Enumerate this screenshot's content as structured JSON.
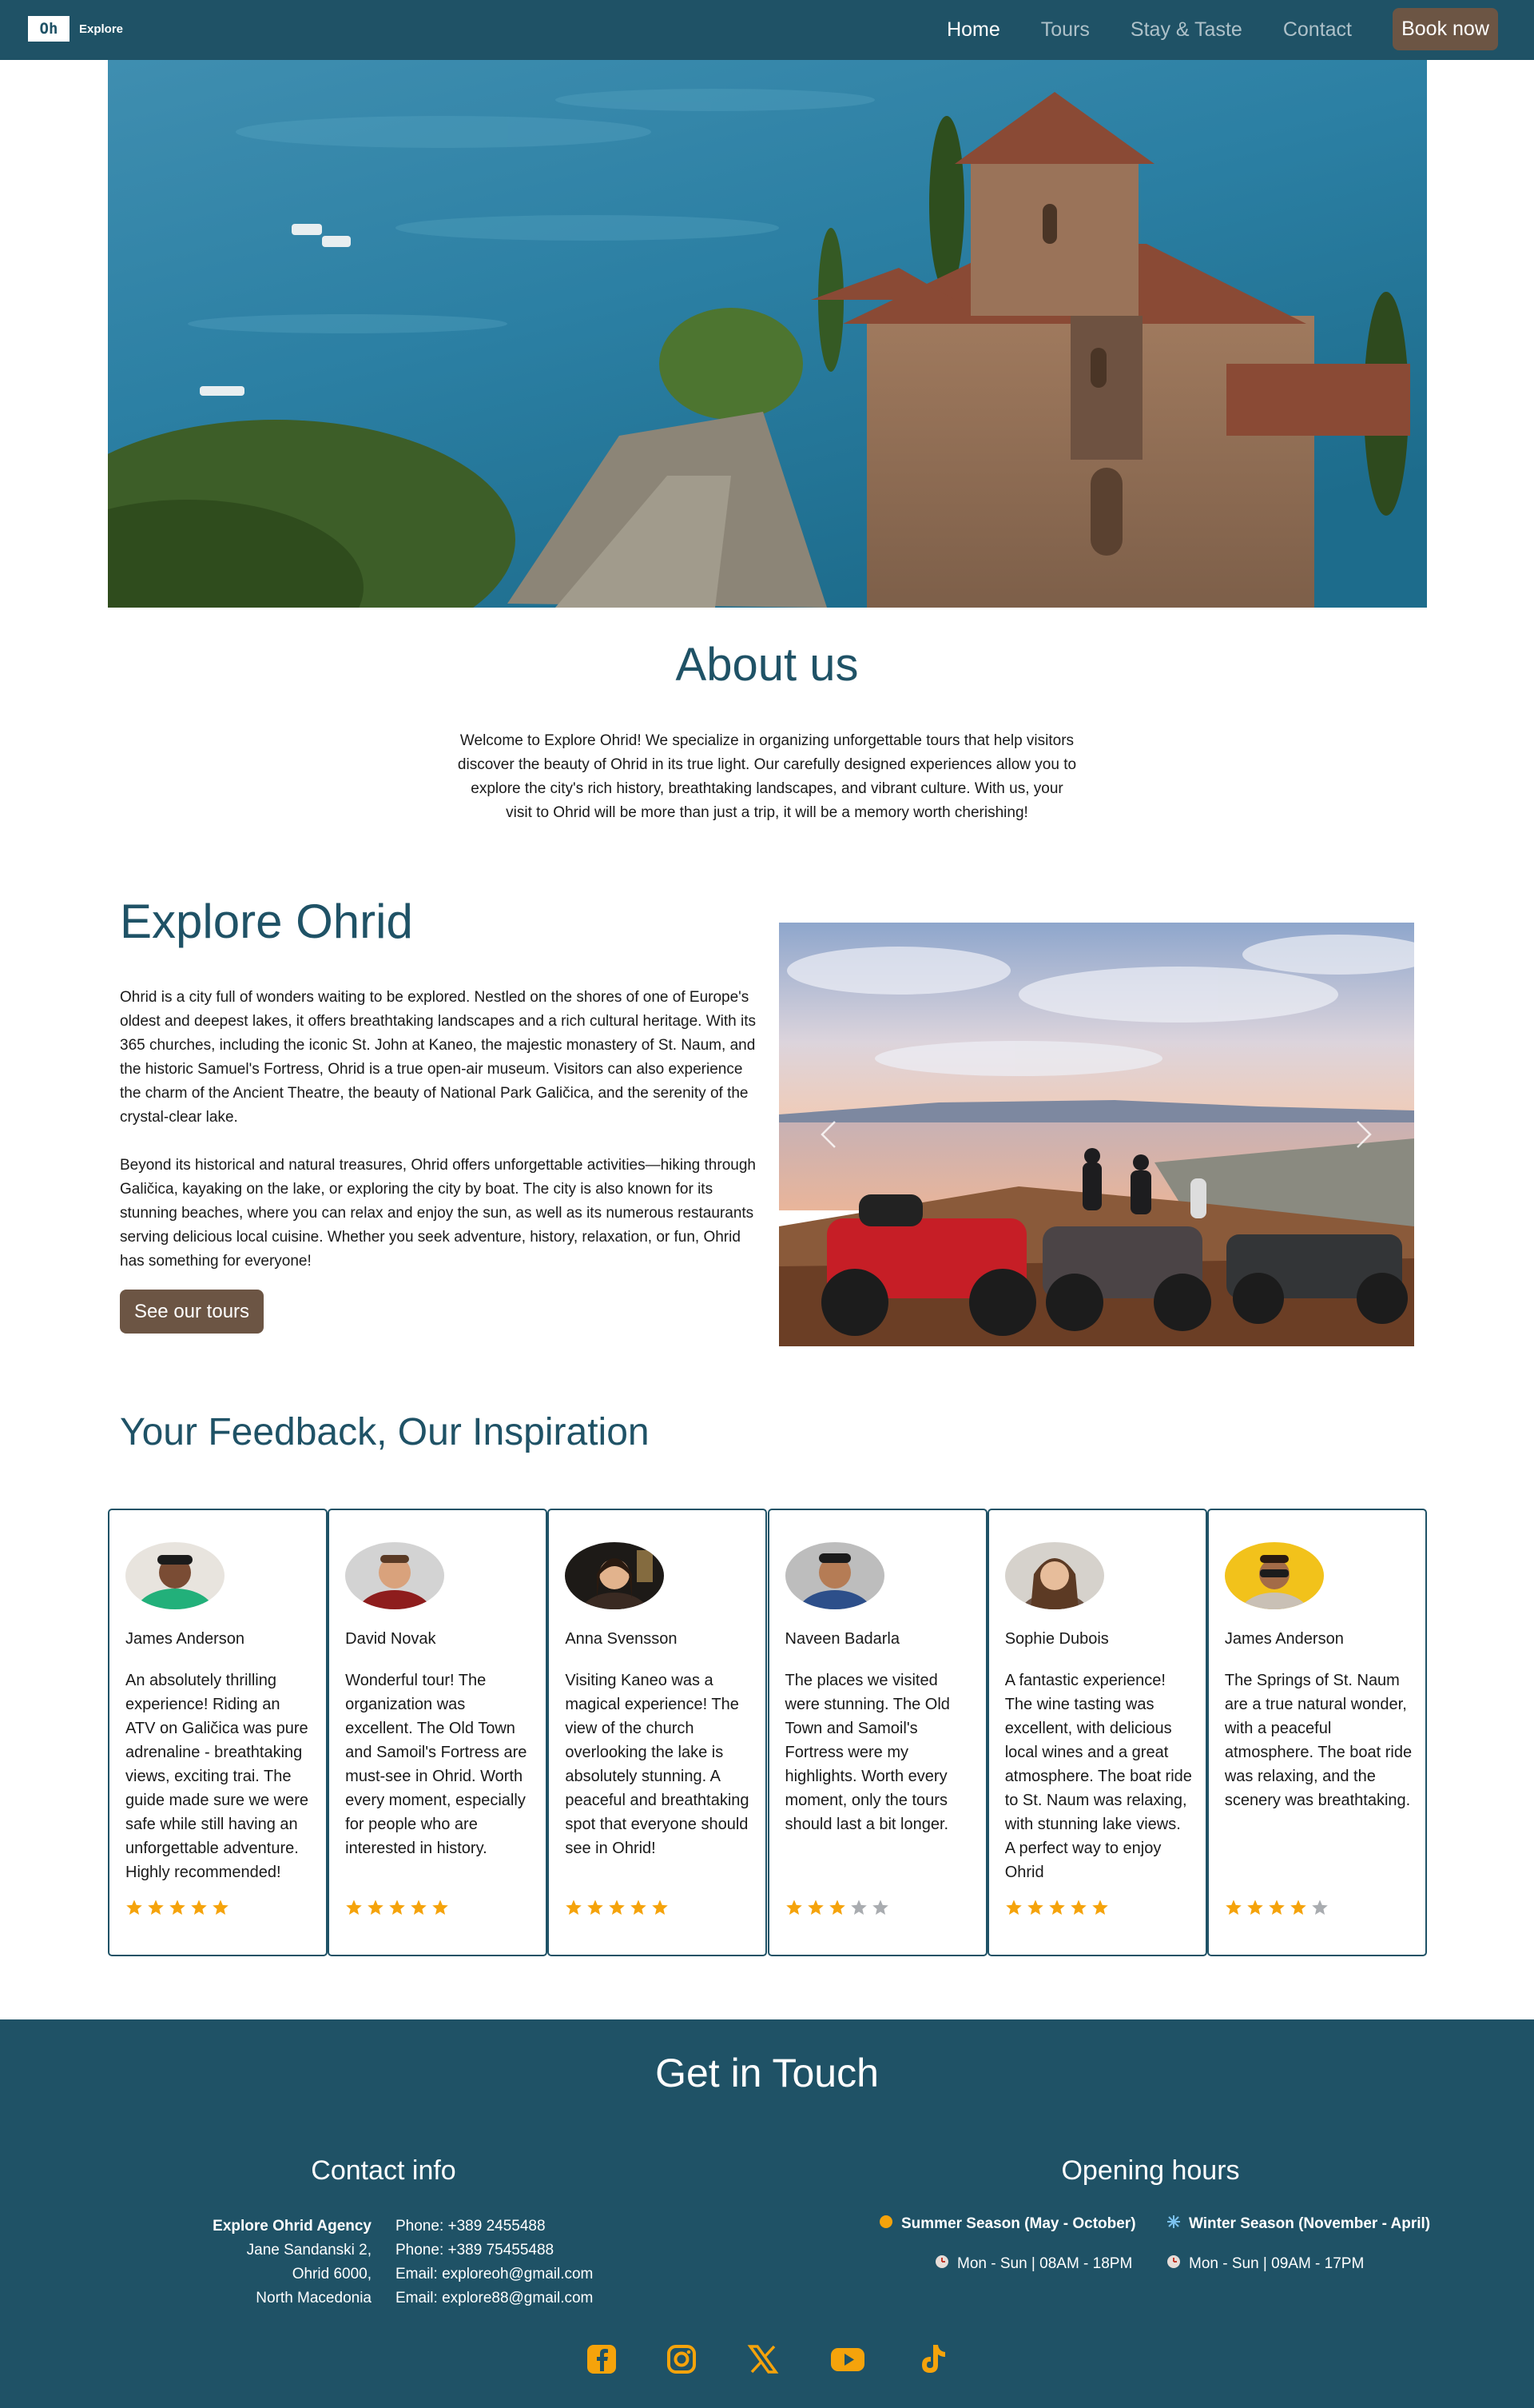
{
  "nav": {
    "logo_mark": "Oh",
    "logo_text": "Explore",
    "links": [
      "Home",
      "Tours",
      "Stay & Taste",
      "Contact"
    ],
    "active": "Home",
    "book_label": "Book now"
  },
  "about": {
    "title": "About us",
    "text": "Welcome to Explore Ohrid! We specialize in organizing unforgettable tours that help visitors discover the beauty of Ohrid in its true light. Our carefully designed experiences allow you to explore the city's rich history, breathtaking landscapes, and vibrant culture. With us, your visit to Ohrid will be more than just a trip, it will be a memory worth cherishing!"
  },
  "explore": {
    "title": "Explore Ohrid",
    "p1": "Ohrid is a city full of wonders waiting to be explored. Nestled on the shores of one of Europe's oldest and deepest lakes, it offers breathtaking landscapes and a rich cultural heritage. With its 365 churches, including the iconic St. John at Kaneo, the majestic monastery of St. Naum, and the historic Samuel's Fortress, Ohrid is a true open-air museum. Visitors can also experience the charm of the Ancient Theatre, the beauty of National Park Galičica, and the serenity of the crystal-clear lake.",
    "p2": "Beyond its historical and natural treasures, Ohrid offers unforgettable activities—hiking through Galičica, kayaking on the lake, or exploring the city by boat. The city is also known for its stunning beaches, where you can relax and enjoy the sun, as well as its numerous restaurants serving delicious local cuisine. Whether you seek adventure, history, relaxation, or fun, Ohrid has something for everyone!",
    "button": "See our tours"
  },
  "feedback": {
    "title": "Your Feedback, Our Inspiration",
    "reviews": [
      {
        "name": "James Anderson",
        "text": "An absolutely thrilling experience! Riding an ATV on Galičica was pure adrenaline - breathtaking views, exciting trai. The guide made sure we were safe while still having an unforgettable adventure. Highly recommended!",
        "rating": 5
      },
      {
        "name": "David Novak",
        "text": "Wonderful tour! The organization was excellent. The Old Town and Samoil's Fortress are must-see in Ohrid. Worth every moment, especially for people who are interested in history.",
        "rating": 5
      },
      {
        "name": "Anna Svensson",
        "text": "Visiting Kaneo was a magical experience! The view of the church overlooking the lake is absolutely stunning. A peaceful and breathtaking spot that everyone should see in Ohrid!",
        "rating": 5
      },
      {
        "name": "Naveen Badarla",
        "text": "The places we visited were stunning. The Old Town and Samoil's Fortress were my highlights. Worth every moment, only the tours should last a bit longer.",
        "rating": 3
      },
      {
        "name": "Sophie Dubois",
        "text": "A fantastic experience! The wine tasting was excellent, with delicious local wines and a great atmosphere. The boat ride to St. Naum was relaxing, with stunning lake views. A perfect way to enjoy Ohrid",
        "rating": 5
      },
      {
        "name": "James Anderson",
        "text": "The Springs of St. Naum are a true natural wonder, with a peaceful atmosphere. The boat ride was relaxing, and the scenery was breathtaking.",
        "rating": 4
      }
    ]
  },
  "footer": {
    "title": "Get in Touch",
    "contact_title": "Contact info",
    "agency": "Explore Ohrid Agency",
    "address": [
      "Jane Sandanski 2,",
      "Ohrid 6000,",
      "North Macedonia"
    ],
    "phones": [
      "Phone: +389 2455488",
      "Phone: +389 75455488",
      "Email: exploreoh@gmail.com",
      "Email: explore88@gmail.com"
    ],
    "hours_title": "Opening hours",
    "summer": "Summer Season (May - October)",
    "summer_hours": "Mon - Sun | 08AM - 18PM",
    "winter": "Winter Season (November - April)",
    "winter_hours": "Mon - Sun | 09AM - 17PM",
    "socials": [
      "facebook-icon",
      "instagram-icon",
      "x-icon",
      "youtube-icon",
      "tiktok-icon"
    ]
  },
  "colors": {
    "primary": "#1f5266",
    "button": "#6c5544",
    "star": "#f5a30b",
    "star_empty": "#a9acb0",
    "social": "#f5a30b"
  }
}
